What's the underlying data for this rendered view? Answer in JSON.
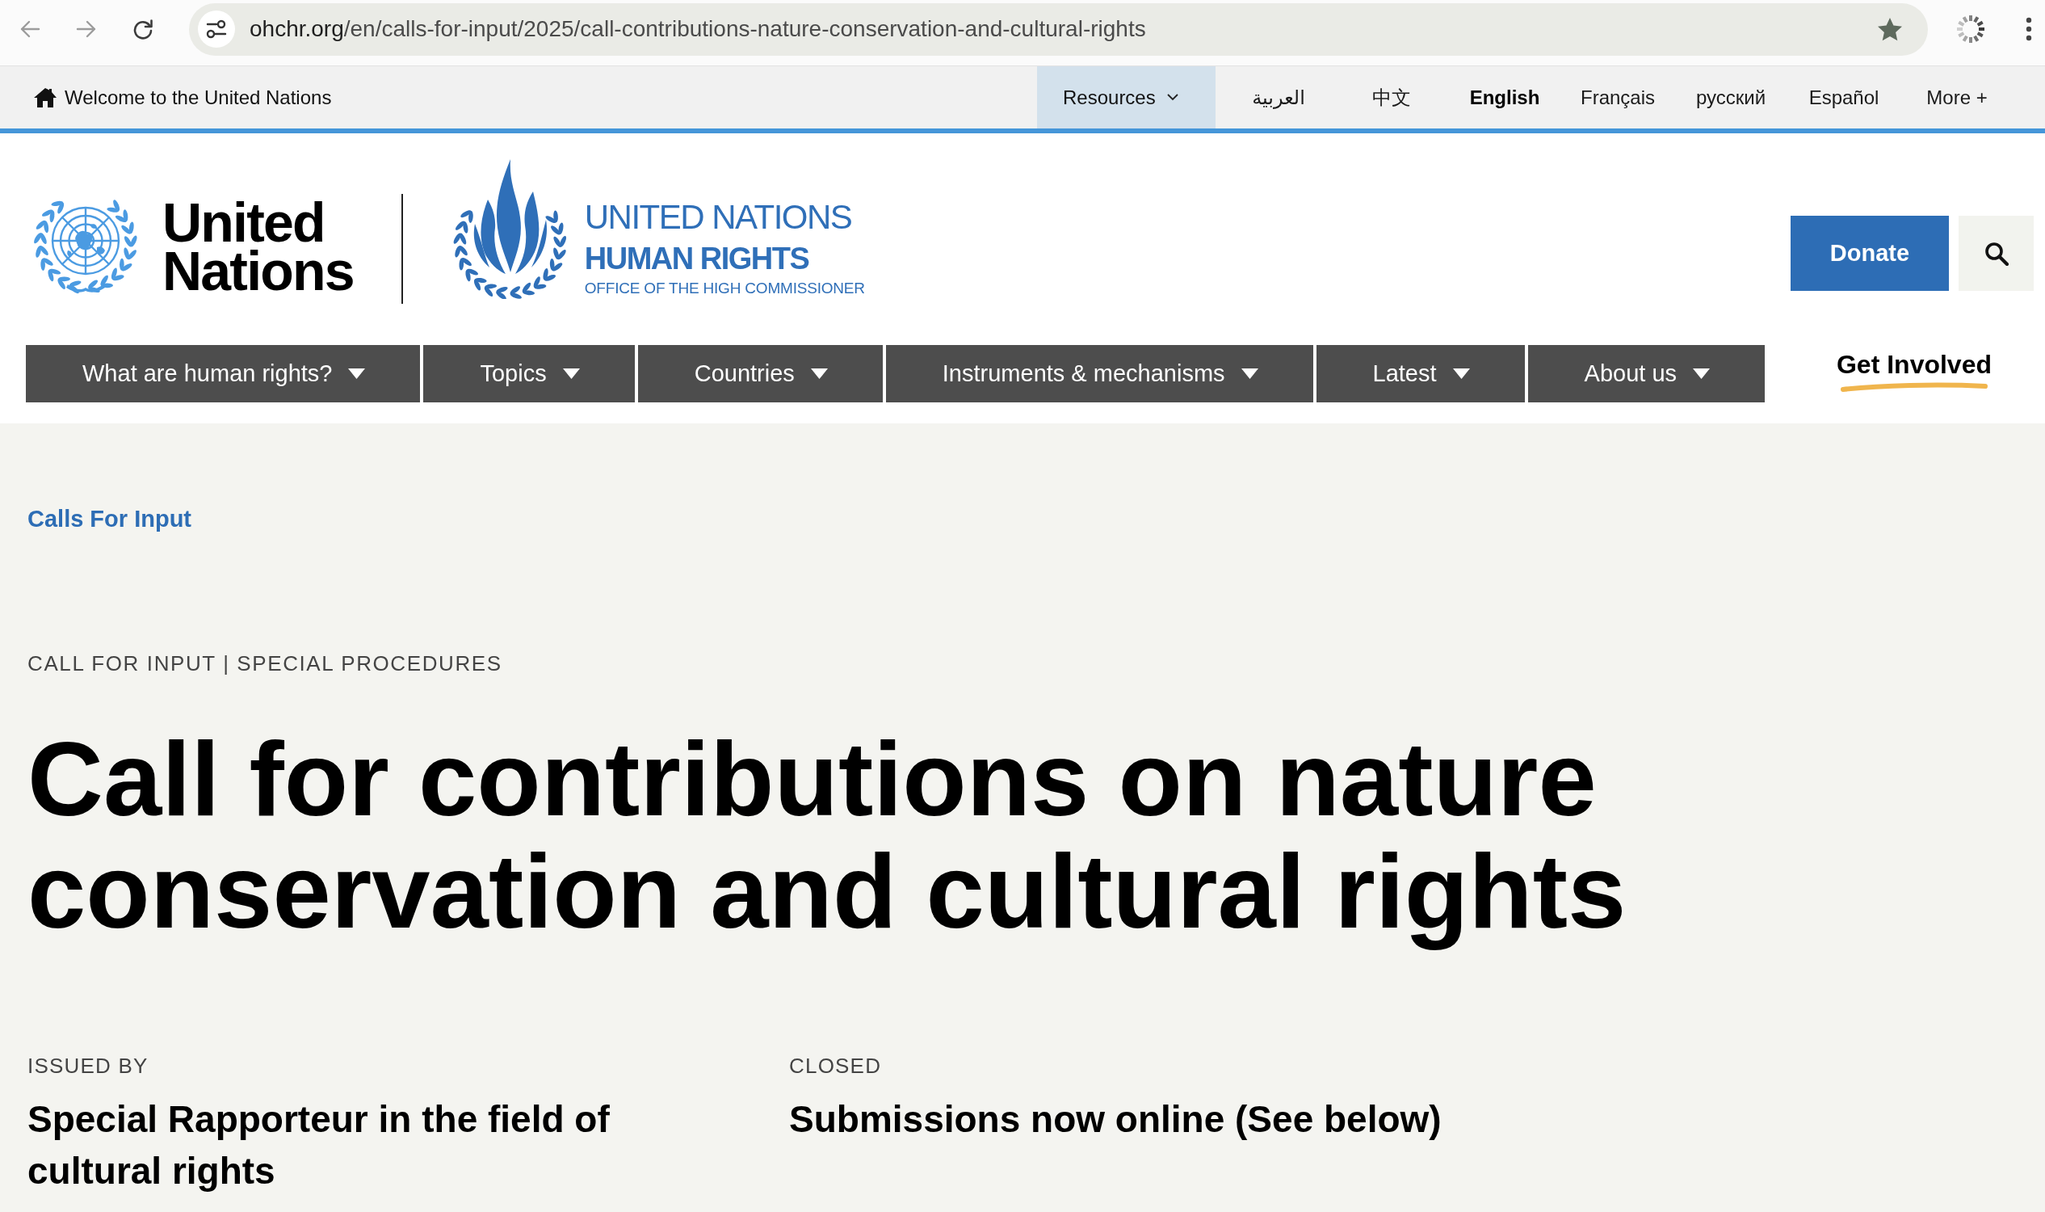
{
  "browser": {
    "url": {
      "host": "ohchr.org",
      "path": "/en/calls-for-input/2025/call-contributions-nature-conservation-and-cultural-rights"
    }
  },
  "un_bar": {
    "home_link": "Welcome to the United Nations",
    "resources": "Resources",
    "languages": [
      {
        "label": "العربية",
        "selected": false
      },
      {
        "label": "中文",
        "selected": false
      },
      {
        "label": "English",
        "selected": true
      },
      {
        "label": "Français",
        "selected": false
      },
      {
        "label": "русский",
        "selected": false
      },
      {
        "label": "Español",
        "selected": false
      }
    ],
    "more": "More +"
  },
  "header": {
    "un_logo": [
      "United",
      "Nations"
    ],
    "ohchr_logo": [
      "UNITED NATIONS",
      "HUMAN RIGHTS",
      "OFFICE OF THE HIGH COMMISSIONER"
    ],
    "donate": "Donate"
  },
  "nav": [
    {
      "label": "What are human rights?",
      "kind": "dropdown"
    },
    {
      "label": "Topics",
      "kind": "dropdown"
    },
    {
      "label": "Countries",
      "kind": "dropdown"
    },
    {
      "label": "Instruments & mechanisms",
      "kind": "dropdown"
    },
    {
      "label": "Latest",
      "kind": "dropdown"
    },
    {
      "label": "About us",
      "kind": "dropdown"
    },
    {
      "label": "Get Involved",
      "kind": "highlight"
    }
  ],
  "breadcrumb": "Calls For Input",
  "call": {
    "eyebrow": "CALL FOR INPUT | SPECIAL PROCEDURES",
    "title": "Call for contributions on nature conservation and cultural rights",
    "details": [
      {
        "label": "ISSUED BY",
        "value": "Special Rapporteur in the field of cultural rights"
      },
      {
        "label": "CLOSED",
        "value": "Submissions now online (See below)"
      }
    ]
  }
}
